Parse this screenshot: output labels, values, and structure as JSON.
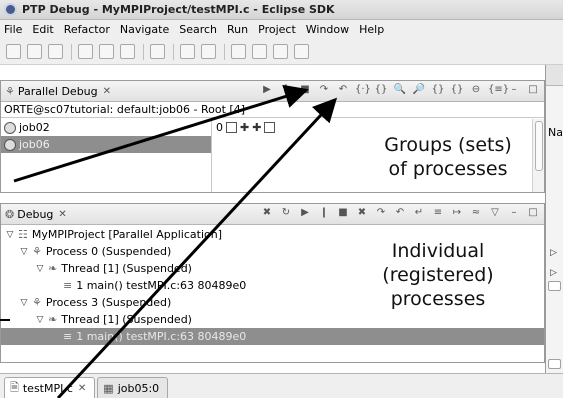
{
  "window": {
    "title": "PTP Debug - MyMPIProject/testMPI.c - Eclipse SDK"
  },
  "menu": [
    "File",
    "Edit",
    "Refactor",
    "Navigate",
    "Search",
    "Run",
    "Project",
    "Window",
    "Help"
  ],
  "parallel_debug": {
    "tab_label": "Parallel Debug",
    "path": "ORTE@sc07tutorial: default:job06 - Root [4]",
    "jobs": [
      "job02",
      "job06"
    ],
    "process_index_label": "0"
  },
  "debug_view": {
    "tab_label": "Debug",
    "tree": [
      {
        "text": "MyMPIProject [Parallel Application]"
      },
      {
        "text": "Process 0 (Suspended)"
      },
      {
        "text": "Thread [1] (Suspended)"
      },
      {
        "text": "1 main() testMPI.c:63 80489e0"
      },
      {
        "text": "Process 3 (Suspended)"
      },
      {
        "text": "Thread [1] (Suspended)"
      },
      {
        "text": "1 main() testMPI.c:63 80489e0"
      }
    ]
  },
  "editor_tabs": [
    {
      "label": "testMPI.c"
    },
    {
      "label": "job05:0"
    }
  ],
  "right_panel": {
    "column_label": "Na"
  },
  "annotations": {
    "groups_line1": "Groups (sets)",
    "groups_line2": "of processes",
    "individual_line1": "Individual",
    "individual_line2": "(registered)",
    "individual_line3": "processes"
  },
  "colors": {
    "selection": "#8e8e8e",
    "arrow": "#000000"
  }
}
